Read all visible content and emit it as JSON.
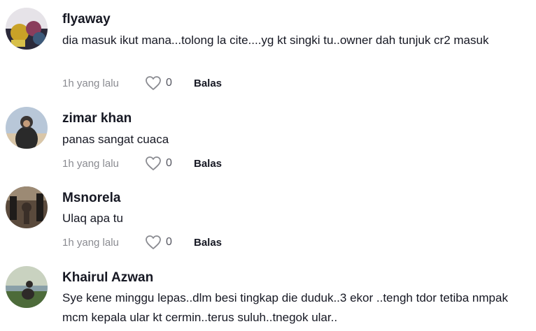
{
  "comments": [
    {
      "username": "flyaway",
      "text": "dia masuk ikut mana...tolong la cite....yg kt singki tu..owner dah tunjuk cr2 masuk",
      "time": "1h yang lalu",
      "likes": "0",
      "reply_label": "Balas",
      "avatar_colors": [
        "#2b2a3a",
        "#c9a227",
        "#8a3d5c"
      ]
    },
    {
      "username": "zimar khan",
      "text": "panas sangat cuaca",
      "time": "1h yang lalu",
      "likes": "0",
      "reply_label": "Balas",
      "avatar_colors": [
        "#b8c7d8",
        "#2a2a2a",
        "#d9c6a8"
      ]
    },
    {
      "username": "Msnorela",
      "text": "Ulaq apa tu",
      "time": "1h yang lalu",
      "likes": "0",
      "reply_label": "Balas",
      "avatar_colors": [
        "#5a4a3c",
        "#1f1c1a",
        "#9c8a74"
      ]
    },
    {
      "username": "Khairul Azwan",
      "text": "Sye kene minggu lepas..dlm besi tingkap die duduk..3 ekor ..tengh tdor tetiba nmpak mcm kepala ular kt cermin..terus suluh..tnegok ular..",
      "time": "",
      "likes": "",
      "reply_label": "",
      "avatar_colors": [
        "#c9d2c0",
        "#4d6b3a",
        "#2e2a28"
      ]
    }
  ]
}
